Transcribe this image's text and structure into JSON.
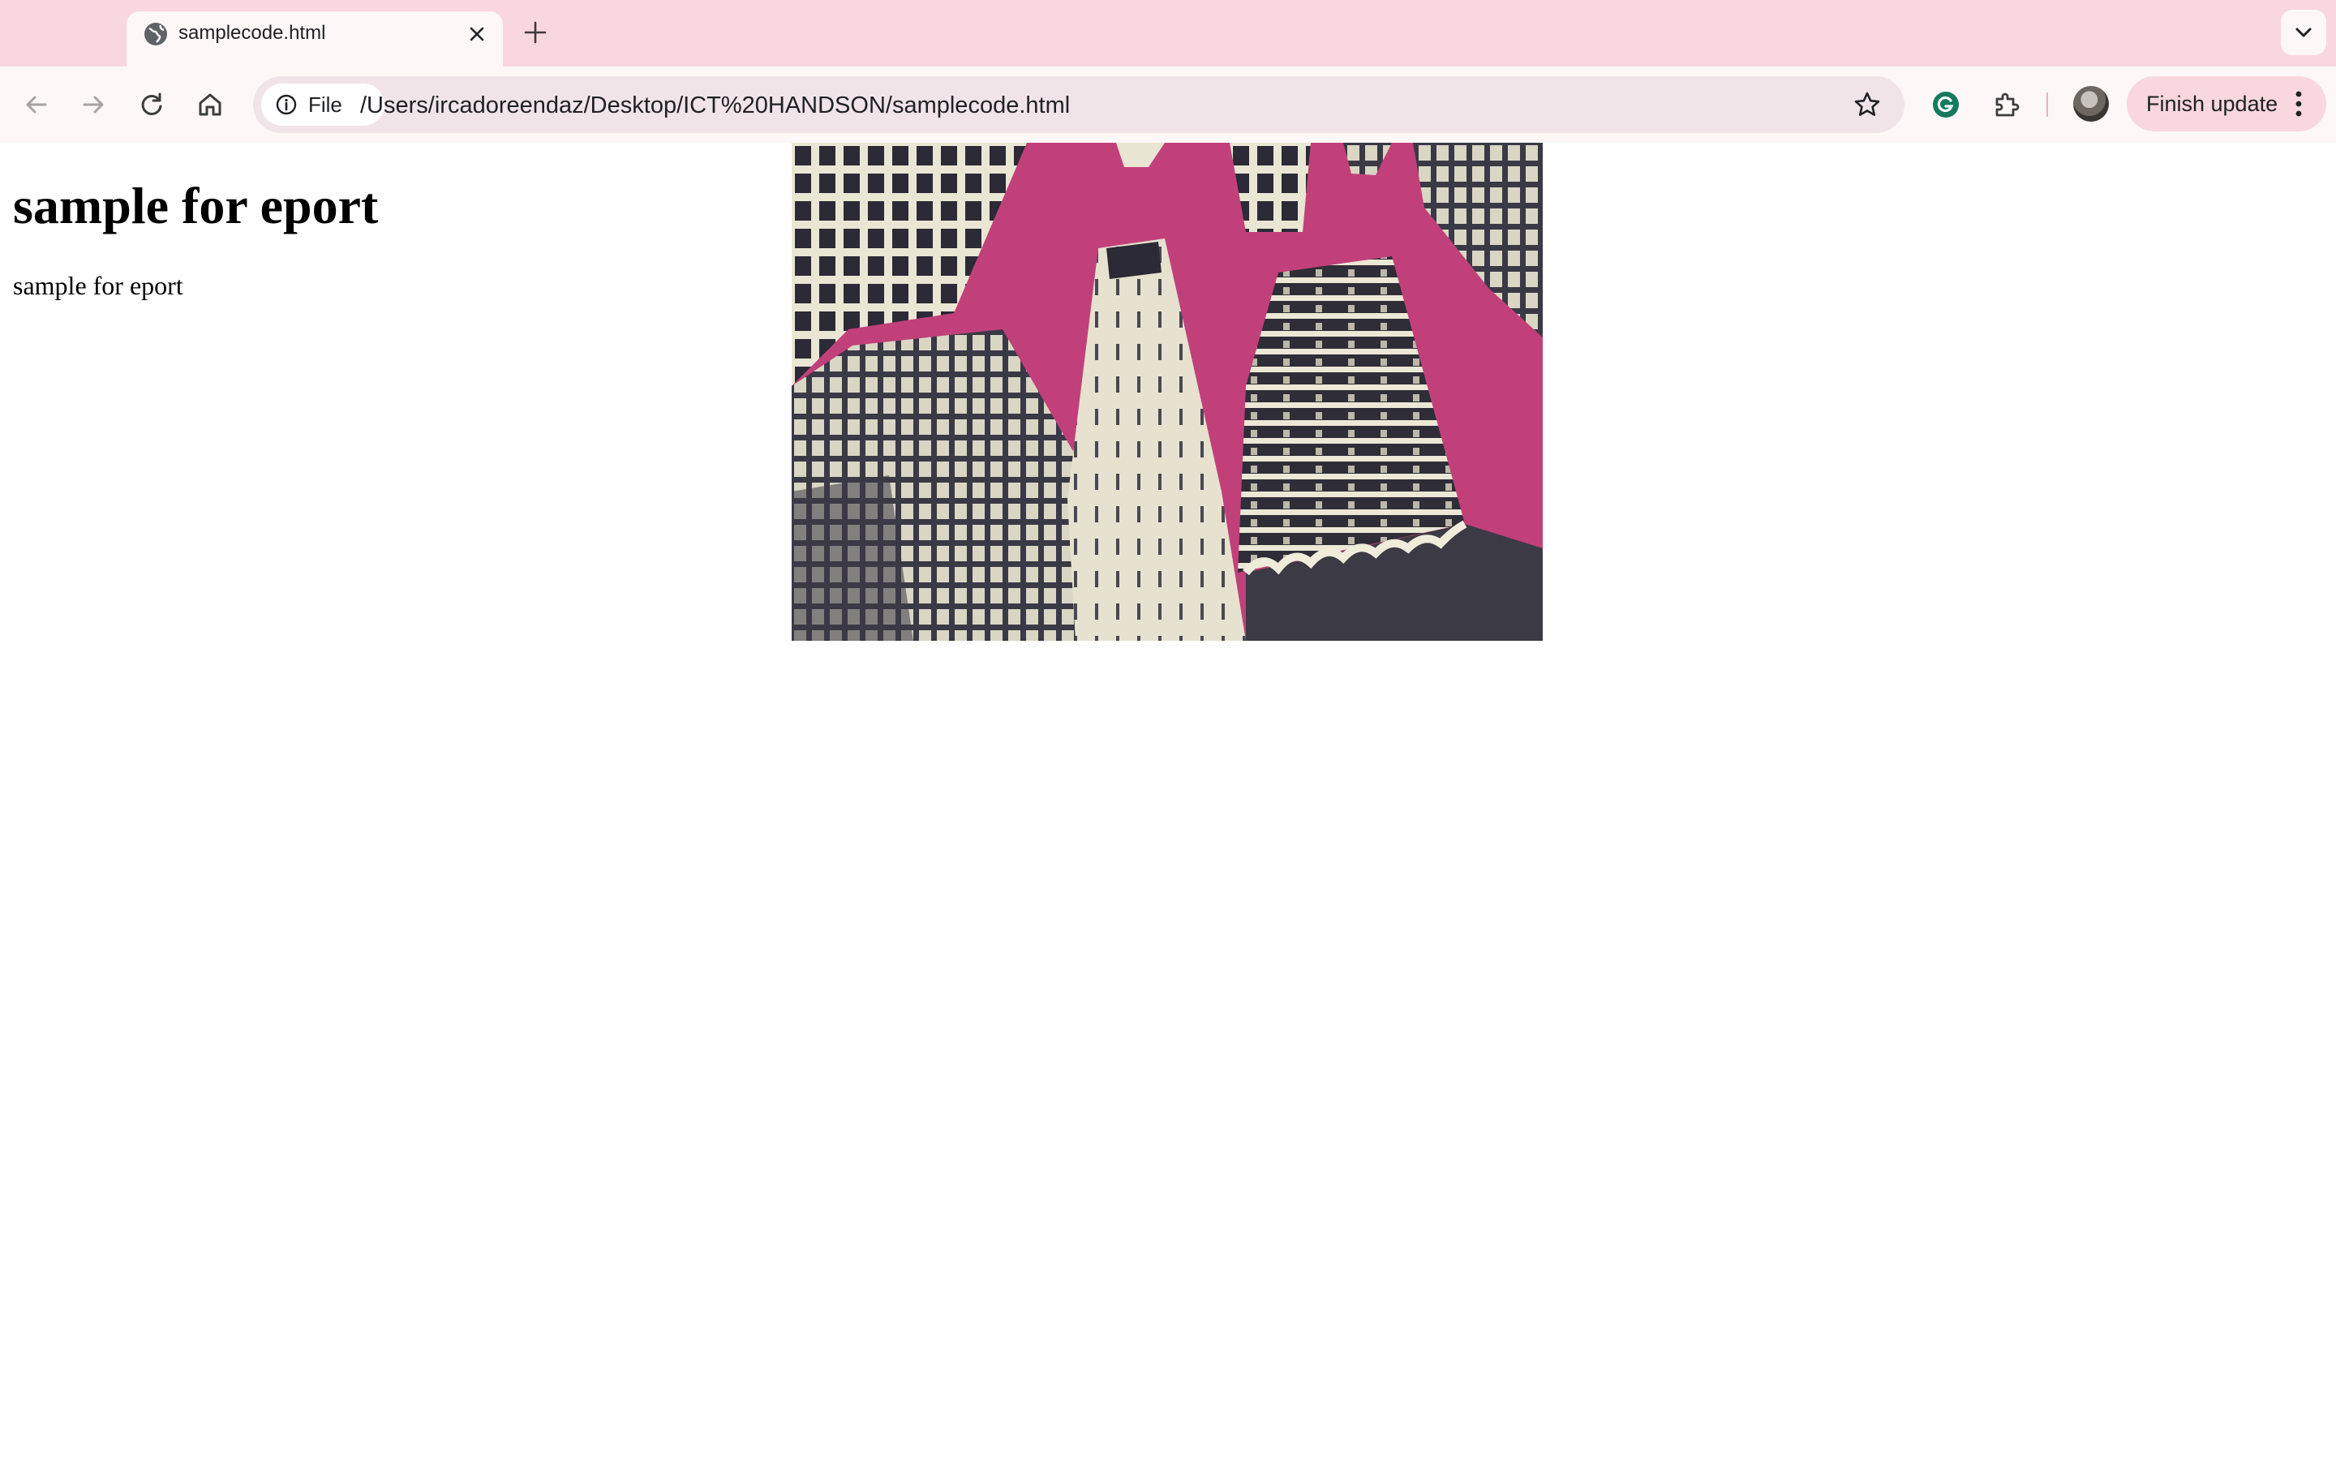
{
  "tab": {
    "title": "samplecode.html"
  },
  "omnibox": {
    "chip_label": "File",
    "url": "/Users/ircadoreendaz/Desktop/ICT%20HANDSON/samplecode.html"
  },
  "toolbar": {
    "finish_update_label": "Finish update"
  },
  "page": {
    "heading": "sample for eport",
    "paragraph": "sample for eport"
  },
  "colors": {
    "tabstrip": "#f8d7df",
    "toolbar": "#fef7f8",
    "image_magenta": "#c0407a"
  },
  "icons": [
    "globe-icon",
    "close-icon",
    "plus-icon",
    "chevron-down-icon",
    "back-arrow-icon",
    "forward-arrow-icon",
    "reload-icon",
    "home-icon",
    "info-icon",
    "star-icon",
    "grammarly-icon",
    "extensions-icon",
    "avatar",
    "more-vert-icon"
  ]
}
